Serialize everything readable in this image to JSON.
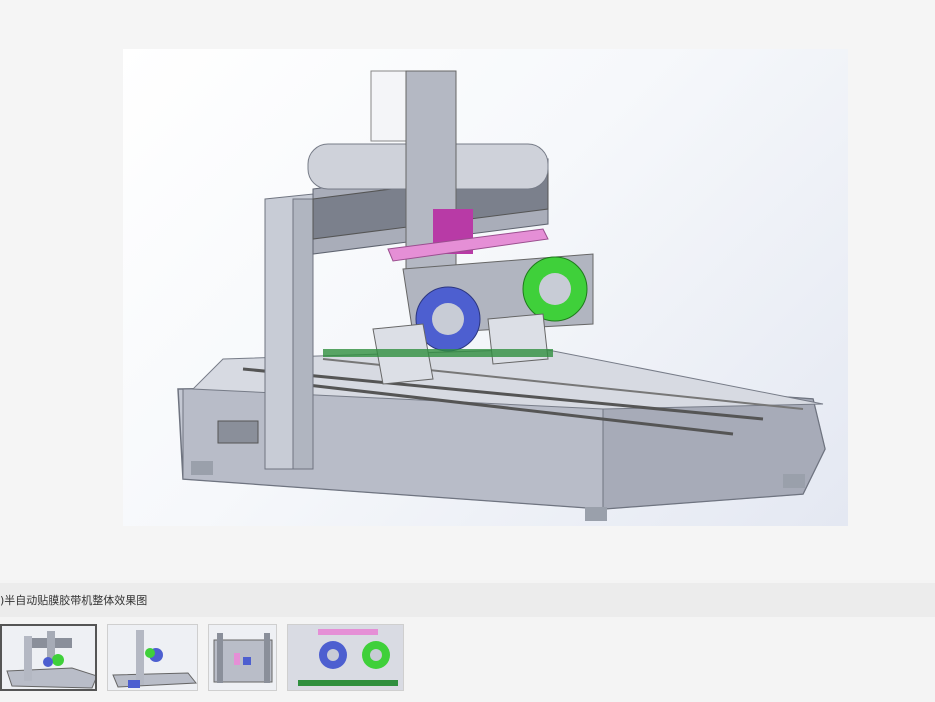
{
  "viewer": {
    "main_image_alt": "",
    "caption": ")半自动贴膜胶带机整体效果图"
  },
  "thumbnails": [
    {
      "index": 1,
      "selected": true
    },
    {
      "index": 2,
      "selected": false
    },
    {
      "index": 3,
      "selected": false
    },
    {
      "index": 4,
      "selected": false
    }
  ],
  "colors": {
    "frame": "#b9bdc8",
    "frame_dark": "#7d828f",
    "pink_plate": "#e58fd6",
    "blue_reel": "#4d5fd0",
    "green_reel": "#3fd03a",
    "background": "#f4f4f4"
  }
}
